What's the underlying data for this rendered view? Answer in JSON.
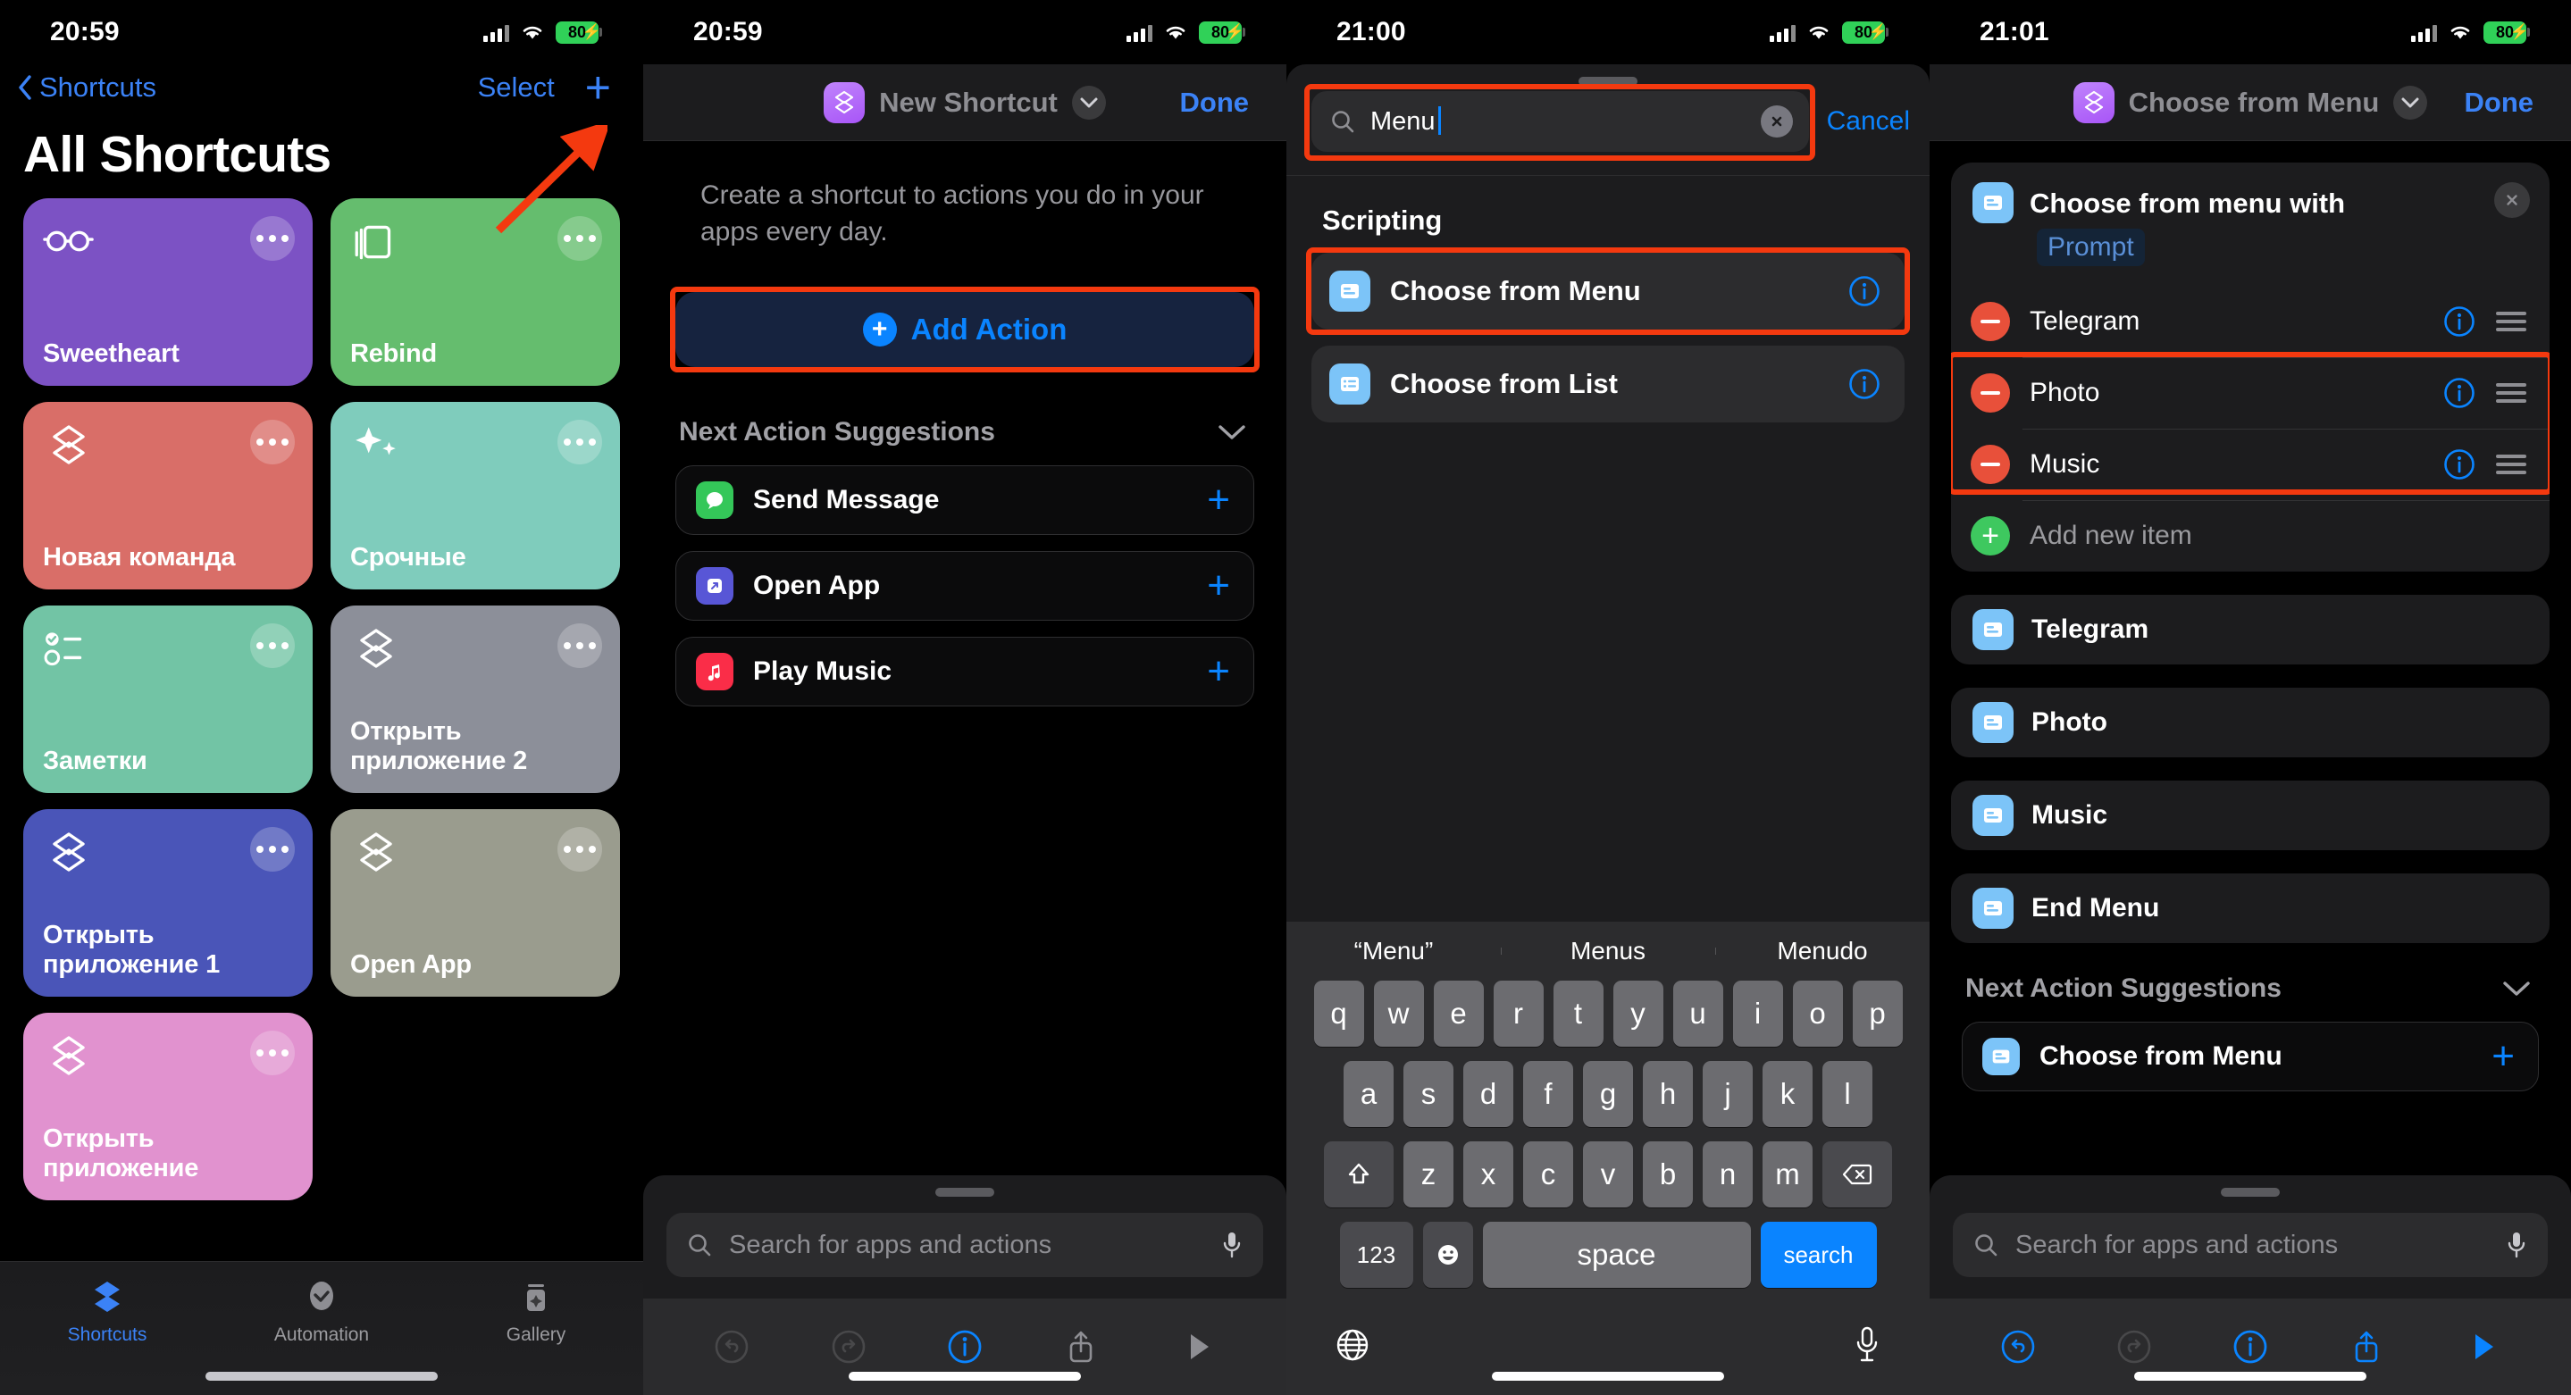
{
  "panel1": {
    "status": {
      "time": "20:59",
      "battery": "80"
    },
    "nav": {
      "back_label": "Shortcuts",
      "select_label": "Select",
      "add_label": "+"
    },
    "title": "All Shortcuts",
    "tiles": [
      {
        "label": "Sweetheart",
        "color": "#7c52c4",
        "icon": "glasses-icon"
      },
      {
        "label": "Rebind",
        "color": "#65bd6e",
        "icon": "books-icon"
      },
      {
        "label": "Новая команда",
        "color": "#d96e68",
        "icon": "shortcuts-icon"
      },
      {
        "label": "Срочные",
        "color": "#7fccbc",
        "icon": "sparkles-icon"
      },
      {
        "label": "Заметки",
        "color": "#72c4a5",
        "icon": "checklist-icon"
      },
      {
        "label": "Открыть приложение 2",
        "color": "#8c8f99",
        "icon": "shortcuts-icon"
      },
      {
        "label": "Открыть приложение 1",
        "color": "#4a55b8",
        "icon": "shortcuts-icon"
      },
      {
        "label": "Open App",
        "color": "#9a9c8e",
        "icon": "shortcuts-icon"
      },
      {
        "label": "Открыть приложение",
        "color": "#e192cf",
        "icon": "shortcuts-icon"
      }
    ],
    "tabs": [
      {
        "label": "Shortcuts",
        "icon": "shortcuts-tab-icon",
        "active": true
      },
      {
        "label": "Automation",
        "icon": "automation-tab-icon",
        "active": false
      },
      {
        "label": "Gallery",
        "icon": "gallery-tab-icon",
        "active": false
      }
    ]
  },
  "panel2": {
    "status": {
      "time": "20:59",
      "battery": "80"
    },
    "header": {
      "title": "New Shortcut",
      "done_label": "Done"
    },
    "description": "Create a shortcut to actions you do in your apps every day.",
    "add_action_label": "Add Action",
    "suggestions_title": "Next Action Suggestions",
    "suggestions": [
      {
        "label": "Send Message",
        "icon": "messages-icon",
        "color": "#34c759"
      },
      {
        "label": "Open App",
        "icon": "open-app-icon",
        "color": "#5856d6"
      },
      {
        "label": "Play Music",
        "icon": "music-icon",
        "color": "#fa2d48"
      }
    ],
    "search_placeholder": "Search for apps and actions",
    "toolbar": [
      "undo-icon",
      "redo-icon",
      "info-icon",
      "share-icon",
      "play-icon"
    ]
  },
  "panel3": {
    "status": {
      "time": "21:00",
      "battery": "80"
    },
    "search_value": "Menu",
    "cancel_label": "Cancel",
    "section_title": "Scripting",
    "results": [
      {
        "label": "Choose from Menu",
        "icon": "choose-from-menu-icon"
      },
      {
        "label": "Choose from List",
        "icon": "choose-from-list-icon"
      }
    ],
    "predictions": [
      "“Menu”",
      "Menus",
      "Menudo"
    ],
    "keyboard": {
      "row1": [
        "q",
        "w",
        "e",
        "r",
        "t",
        "y",
        "u",
        "i",
        "o",
        "p"
      ],
      "row2": [
        "a",
        "s",
        "d",
        "f",
        "g",
        "h",
        "j",
        "k",
        "l"
      ],
      "row3": [
        "z",
        "x",
        "c",
        "v",
        "b",
        "n",
        "m"
      ],
      "num_label": "123",
      "space_label": "space",
      "search_label": "search",
      "shift_icon": "shift-icon",
      "backspace_icon": "backspace-icon",
      "emoji_icon": "emoji-icon",
      "globe_icon": "globe-icon",
      "dictation_icon": "microphone-icon"
    }
  },
  "panel4": {
    "status": {
      "time": "21:01",
      "battery": "80"
    },
    "header": {
      "title": "Choose from Menu",
      "done_label": "Done"
    },
    "card": {
      "title": "Choose from menu with",
      "prompt_placeholder": "Prompt",
      "items": [
        "Telegram",
        "Photo",
        "Music"
      ],
      "add_item_label": "Add new item"
    },
    "actions": [
      "Telegram",
      "Photo",
      "Music",
      "End Menu"
    ],
    "suggestions_title": "Next Action Suggestions",
    "suggestion": {
      "label": "Choose from Menu",
      "icon": "choose-from-menu-icon"
    },
    "search_placeholder": "Search for apps and actions",
    "toolbar": [
      "undo-icon",
      "redo-icon",
      "info-icon",
      "share-icon",
      "play-icon"
    ]
  },
  "annotations": {
    "accent_highlight": "#f4390f",
    "arrow": "red-arrow-pointer"
  }
}
